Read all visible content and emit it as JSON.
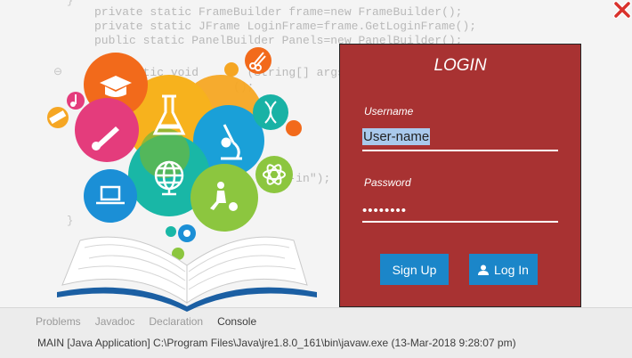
{
  "window": {
    "close_icon": "close-x-icon"
  },
  "code_background": {
    "lines": [
      "private static FrameBuilder frame=new FrameBuilder();",
      "private static JFrame LoginFrame=frame.GetLoginFrame();",
      "public static PanelBuilder Panels=new PanelBuilder();",
      "    static void       (String[] args) {",
      "                    ();",
      "                     ();",
      "",
      "",
      "                          ed-in\");"
    ]
  },
  "console": {
    "tabs": [
      "Problems",
      "Javadoc",
      "Declaration",
      "Console"
    ],
    "active_tab": "Console",
    "status": "MAIN [Java Application] C:\\Program Files\\Java\\jre1.8.0_161\\bin\\javaw.exe (13-Mar-2018 9:28:07 pm)"
  },
  "login": {
    "title": "LOGIN",
    "username_label": "Username",
    "username_value": "User-name",
    "password_label": "Password",
    "password_value": "••••••••",
    "signup_label": "Sign Up",
    "login_label": "Log In",
    "login_icon": "user-icon",
    "colors": {
      "panel": "#a83232",
      "button": "#1b86c9"
    }
  },
  "illustration": {
    "icons": [
      "flask-icon",
      "graduation-cap-icon",
      "microscope-icon",
      "globe-icon",
      "laptop-icon",
      "atom-icon",
      "dna-icon",
      "music-note-icon",
      "scissors-icon",
      "ruler-icon",
      "trumpet-icon",
      "child-ball-icon",
      "gear-icon",
      "open-book-icon"
    ]
  }
}
